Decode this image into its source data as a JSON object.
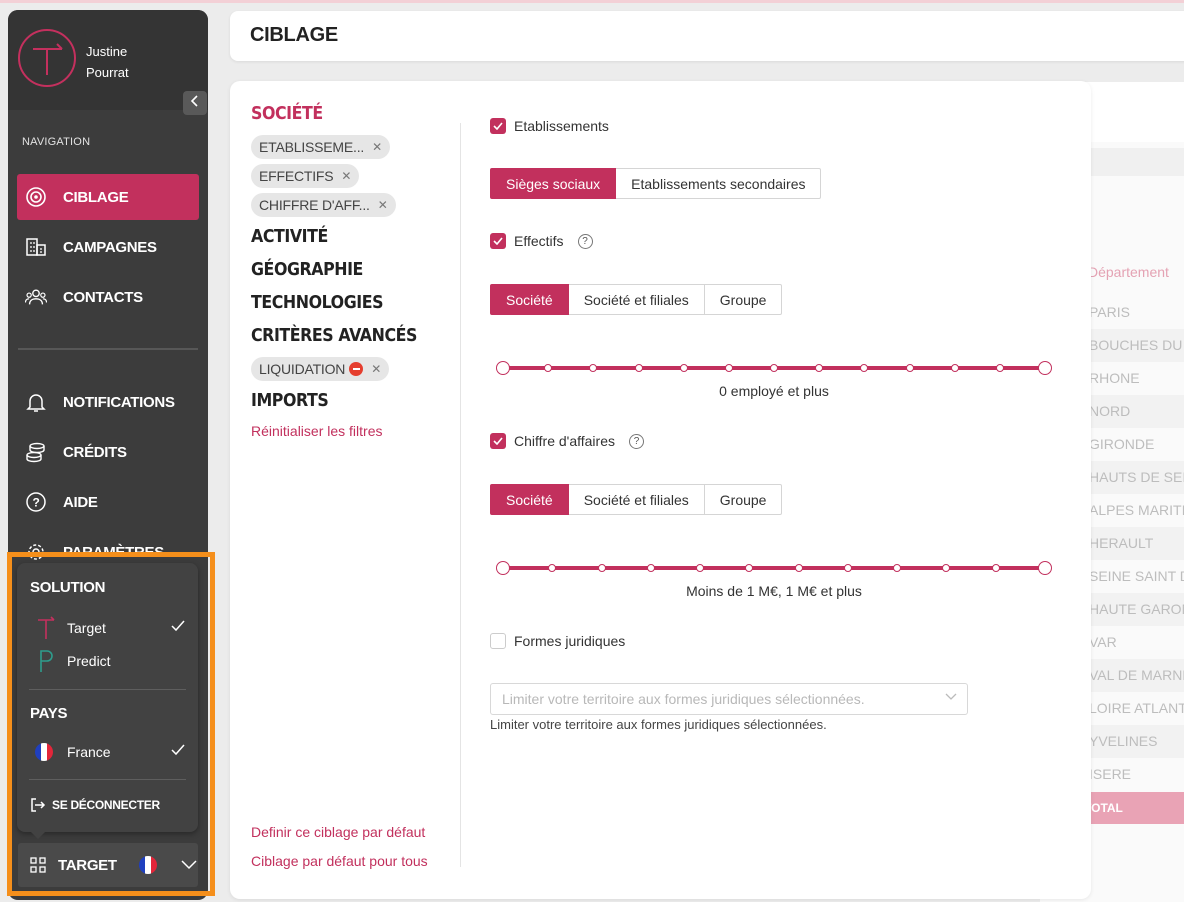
{
  "user": {
    "first_name": "Justine",
    "last_name": "Pourrat"
  },
  "navigation": {
    "label": "NAVIGATION",
    "items": [
      {
        "label": "CIBLAGE",
        "icon": "target-icon",
        "active": true
      },
      {
        "label": "CAMPAGNES",
        "icon": "building-icon"
      },
      {
        "label": "CONTACTS",
        "icon": "people-icon"
      },
      {
        "label": "NOTIFICATIONS",
        "icon": "bell-icon"
      },
      {
        "label": "CRÉDITS",
        "icon": "coins-icon"
      },
      {
        "label": "AIDE",
        "icon": "help-icon"
      },
      {
        "label": "PARAMÈTRES",
        "icon": "gear-icon"
      }
    ]
  },
  "popup": {
    "solution_label": "SOLUTION",
    "solutions": [
      {
        "label": "Target",
        "selected": true
      },
      {
        "label": "Predict",
        "selected": false
      }
    ],
    "country_label": "PAYS",
    "countries": [
      {
        "label": "France",
        "selected": true
      }
    ],
    "logout_label": "SE DÉCONNECTER"
  },
  "bottom_selector": {
    "label": "TARGET"
  },
  "header": {
    "title": "CIBLAGE"
  },
  "filters": {
    "societe": "SOCIÉTÉ",
    "societe_chips": [
      "ETABLISSEME...",
      "EFFECTIFS",
      "CHIFFRE D'AFF..."
    ],
    "activite": "ACTIVITÉ",
    "geographie": "GÉOGRAPHIE",
    "technologies": "TECHNOLOGIES",
    "criteres": "CRITÈRES AVANCÉS",
    "criteres_chips": [
      "LIQUIDATION"
    ],
    "imports": "IMPORTS",
    "reset": "Réinitialiser les filtres",
    "set_default": "Definir ce ciblage par défaut",
    "default_all": "Ciblage par défaut pour tous"
  },
  "criteria": {
    "etablissements": {
      "label": "Etablissements",
      "checked": true,
      "options": [
        "Sièges sociaux",
        "Etablissements secondaires"
      ],
      "selected": "Sièges sociaux"
    },
    "effectifs": {
      "label": "Effectifs",
      "checked": true,
      "options": [
        "Société",
        "Société et filiales",
        "Groupe"
      ],
      "selected": "Société",
      "range_label": "0 employé et plus"
    },
    "ca": {
      "label": "Chiffre d'affaires",
      "checked": true,
      "options": [
        "Société",
        "Société et filiales",
        "Groupe"
      ],
      "selected": "Société",
      "range_label": "Moins de 1 M€, 1 M€ et plus"
    },
    "formes": {
      "label": "Formes juridiques",
      "checked": false,
      "placeholder": "Limiter votre territoire aux formes juridiques sélectionnées.",
      "help": "Limiter votre territoire aux formes juridiques sélectionnées."
    }
  },
  "table": {
    "header": "Département",
    "rows": [
      "PARIS",
      "BOUCHES DU R",
      "RHONE",
      "NORD",
      "GIRONDE",
      "HAUTS DE SEIN",
      "ALPES MARITIM",
      "HERAULT",
      "SEINE SAINT DE",
      "HAUTE GARON",
      "VAR",
      "VAL DE MARNE",
      "LOIRE ATLANTIQ",
      "YVELINES",
      "ISERE"
    ],
    "total": "TOTAL"
  },
  "colors": {
    "accent": "#c2305d",
    "sidebar": "#3c3c3c",
    "highlight": "#f58f1b"
  }
}
